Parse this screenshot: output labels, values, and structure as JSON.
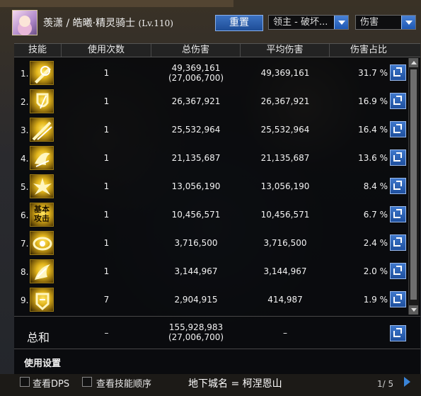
{
  "header": {
    "character": "羡潇 / 皓曦·精灵骑士",
    "level": "(Lv.110)",
    "reset_label": "重置",
    "target_select": "领主 - 破坏...",
    "metric_select": "伤害"
  },
  "table": {
    "columns": [
      "技能",
      "使用次数",
      "总伤害",
      "平均伤害",
      "伤害占比"
    ],
    "rows": [
      {
        "index": "1.",
        "icon": "sun-sword-skill-icon",
        "uses": "1",
        "total": "49,369,161",
        "total_sub": "(27,006,700)",
        "avg": "49,369,161",
        "pct": "31.7 %"
      },
      {
        "index": "2.",
        "icon": "shield-slash-skill-icon",
        "uses": "1",
        "total": "26,367,921",
        "total_sub": "",
        "avg": "26,367,921",
        "pct": "16.9 %"
      },
      {
        "index": "3.",
        "icon": "lance-strike-skill-icon",
        "uses": "1",
        "total": "25,532,964",
        "total_sub": "",
        "avg": "25,532,964",
        "pct": "16.4 %"
      },
      {
        "index": "4.",
        "icon": "flying-knight-skill-icon",
        "uses": "1",
        "total": "21,135,687",
        "total_sub": "",
        "avg": "21,135,687",
        "pct": "13.6 %"
      },
      {
        "index": "5.",
        "icon": "burst-skill-icon",
        "uses": "1",
        "total": "13,056,190",
        "total_sub": "",
        "avg": "13,056,190",
        "pct": "8.4 %"
      },
      {
        "index": "6.",
        "icon": "basic-attack-skill-icon",
        "icon_text": "基本\n攻击",
        "uses": "1",
        "total": "10,456,571",
        "total_sub": "",
        "avg": "10,456,571",
        "pct": "6.7 %"
      },
      {
        "index": "7.",
        "icon": "vortex-skill-icon",
        "uses": "1",
        "total": "3,716,500",
        "total_sub": "",
        "avg": "3,716,500",
        "pct": "2.4 %"
      },
      {
        "index": "8.",
        "icon": "rising-slash-skill-icon",
        "uses": "1",
        "total": "3,144,967",
        "total_sub": "",
        "avg": "3,144,967",
        "pct": "2.0 %"
      },
      {
        "index": "9.",
        "icon": "shield-bash-skill-icon",
        "uses": "7",
        "total": "2,904,915",
        "total_sub": "",
        "avg": "414,987",
        "pct": "1.9 %"
      }
    ],
    "total": {
      "label": "总和",
      "uses": "–",
      "total": "155,928,983",
      "total_sub": "(27,006,700)",
      "avg": "–"
    },
    "settings_label": "使用设置"
  },
  "bottom": {
    "check_dps": "查看DPS",
    "check_order": "查看技能顺序",
    "location": "地下城名 = 柯涅恩山",
    "page": "1/ 5"
  },
  "colors": {
    "accent": "#2a62b6",
    "panel_bg": "#060709",
    "icon_gold": "#e2b51c"
  }
}
